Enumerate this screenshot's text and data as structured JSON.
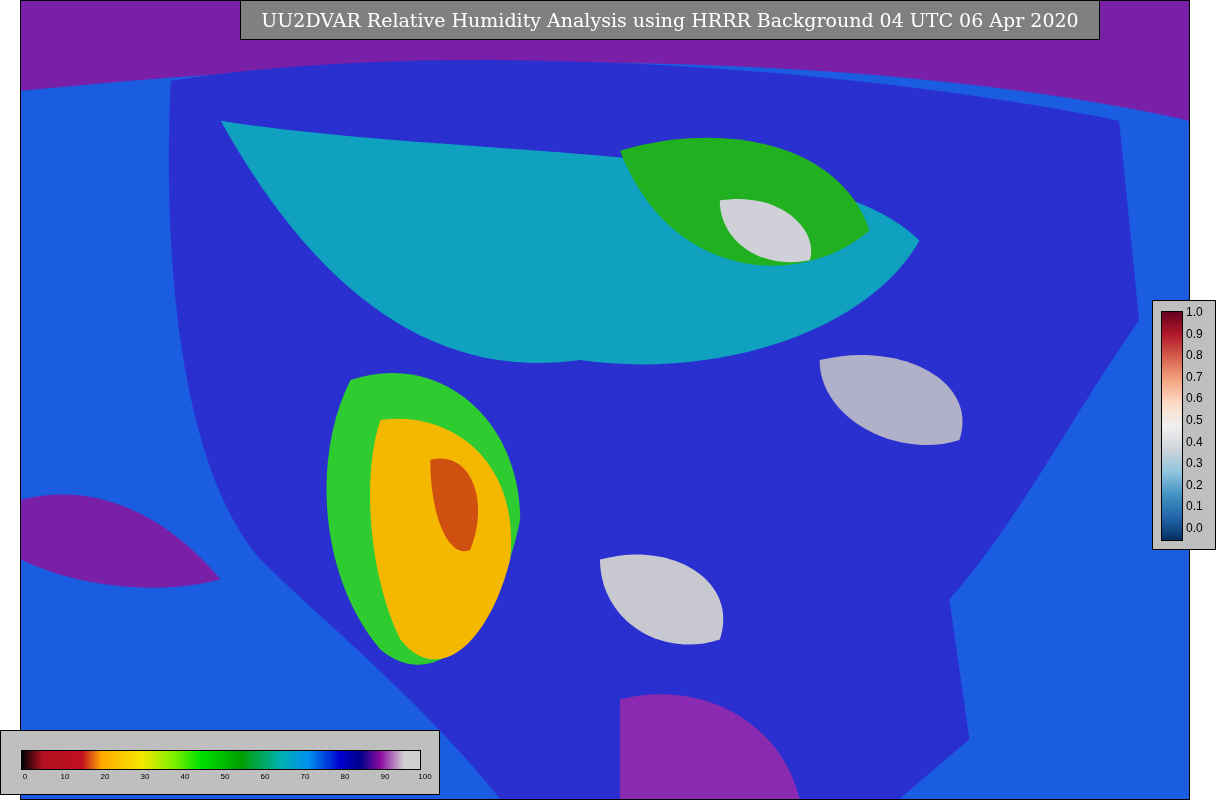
{
  "title": "UU2DVAR Relative Humidity Analysis using HRRR Background 04 UTC 06 Apr 2020",
  "uncertainty_legend": {
    "ticks": [
      "1.0",
      "0.9",
      "0.8",
      "0.7",
      "0.6",
      "0.5",
      "0.4",
      "0.3",
      "0.2",
      "0.1",
      "0.0"
    ]
  },
  "humidity_legend": {
    "ticks": [
      "0",
      "10",
      "20",
      "30",
      "40",
      "50",
      "60",
      "70",
      "80",
      "90",
      "100"
    ]
  }
}
